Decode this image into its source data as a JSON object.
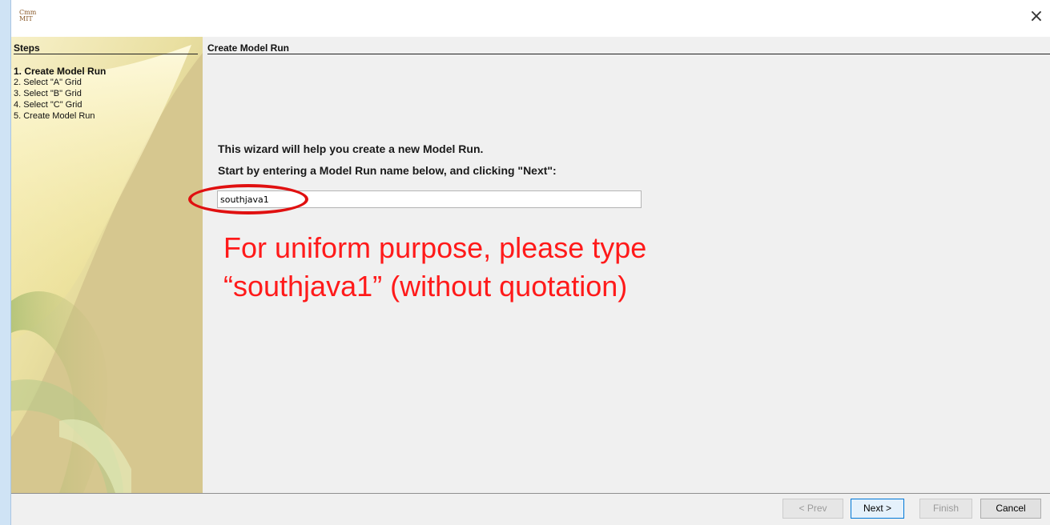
{
  "app": {
    "logo_line1": "Cmm",
    "logo_line2": "MIT",
    "close_glyph": "×"
  },
  "sidebar": {
    "title": "Steps",
    "steps": [
      {
        "label": "1. Create Model Run",
        "active": true
      },
      {
        "label": "2. Select \"A\" Grid",
        "active": false
      },
      {
        "label": "3. Select \"B\" Grid",
        "active": false
      },
      {
        "label": "4. Select \"C\" Grid",
        "active": false
      },
      {
        "label": "5. Create Model Run",
        "active": false
      }
    ]
  },
  "main": {
    "title": "Create Model Run",
    "intro_line1": "This wizard will help you create a new Model Run.",
    "intro_line2": "Start by entering a Model Run name below, and clicking \"Next\":",
    "model_run_name": "southjava1"
  },
  "annotation": {
    "line1": "For uniform purpose, please type",
    "line2": "“southjava1” (without quotation)",
    "color": "#ff1a1a"
  },
  "footer": {
    "prev_label": "< Prev",
    "next_label": "Next >",
    "finish_label": "Finish",
    "cancel_label": "Cancel"
  },
  "colors": {
    "sidebar_base": "#d9c98f",
    "accent_focus": "#0078d7",
    "highlight_ring": "#e01010"
  },
  "icons": {
    "close": "close-icon",
    "logo": "app-logo"
  }
}
